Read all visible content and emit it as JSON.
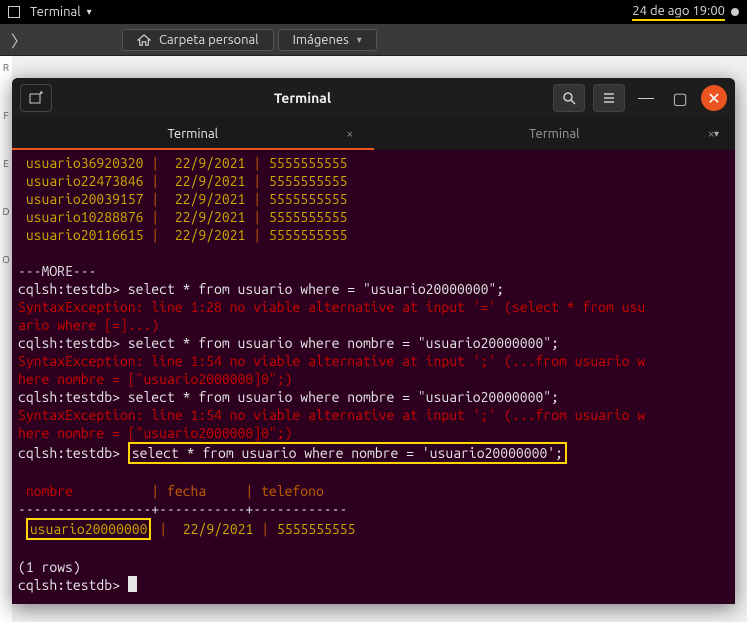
{
  "topbar": {
    "app": "Terminal",
    "date": "24 de ago  19:00"
  },
  "breadcrumb": {
    "home": "Carpeta personal",
    "folder": "Imágenes"
  },
  "window": {
    "title": "Terminal",
    "tab_active": "Terminal",
    "tab_inactive": "Terminal"
  },
  "rows": [
    {
      "user": "usuario36920320",
      "fecha": "22/9/2021",
      "tel": "5555555555"
    },
    {
      "user": "usuario22473846",
      "fecha": "22/9/2021",
      "tel": "5555555555"
    },
    {
      "user": "usuario20039157",
      "fecha": "22/9/2021",
      "tel": "5555555555"
    },
    {
      "user": "usuario10288876",
      "fecha": "22/9/2021",
      "tel": "5555555555"
    },
    {
      "user": "usuario20116615",
      "fecha": "22/9/2021",
      "tel": "5555555555"
    }
  ],
  "more": "---MORE---",
  "prompt": "cqlsh:testdb>",
  "q1": "select * from usuario where = \"usuario20000000\";",
  "err1a": "SyntaxException: line 1:28 no viable alternative at input '=' (select * from usu",
  "err1b": "ario where [=]...)",
  "q2": "select * from usuario where nombre = \"usuario20000000\";",
  "err2a": "SyntaxException: line 1:54 no viable alternative at input ';' (...from usuario w",
  "err2b": "here nombre = [\"usuario2000000]0\";)",
  "q3": "select * from usuario where nombre = \"usuario20000000\";",
  "err3a": "SyntaxException: line 1:54 no viable alternative at input ';' (...from usuario w",
  "err3b": "here nombre = [\"usuario2000000]0\";)",
  "q4": "select * from usuario where nombre = 'usuario20000000';",
  "hdr_nombre": "nombre",
  "hdr_fecha": "fecha",
  "hdr_tel": "telefono",
  "hdr_sep": "-----------------+-----------+------------",
  "result_user": "usuario20000000",
  "result_fecha": "22/9/2021",
  "result_tel": "5555555555",
  "rowcount": "(1 rows)"
}
